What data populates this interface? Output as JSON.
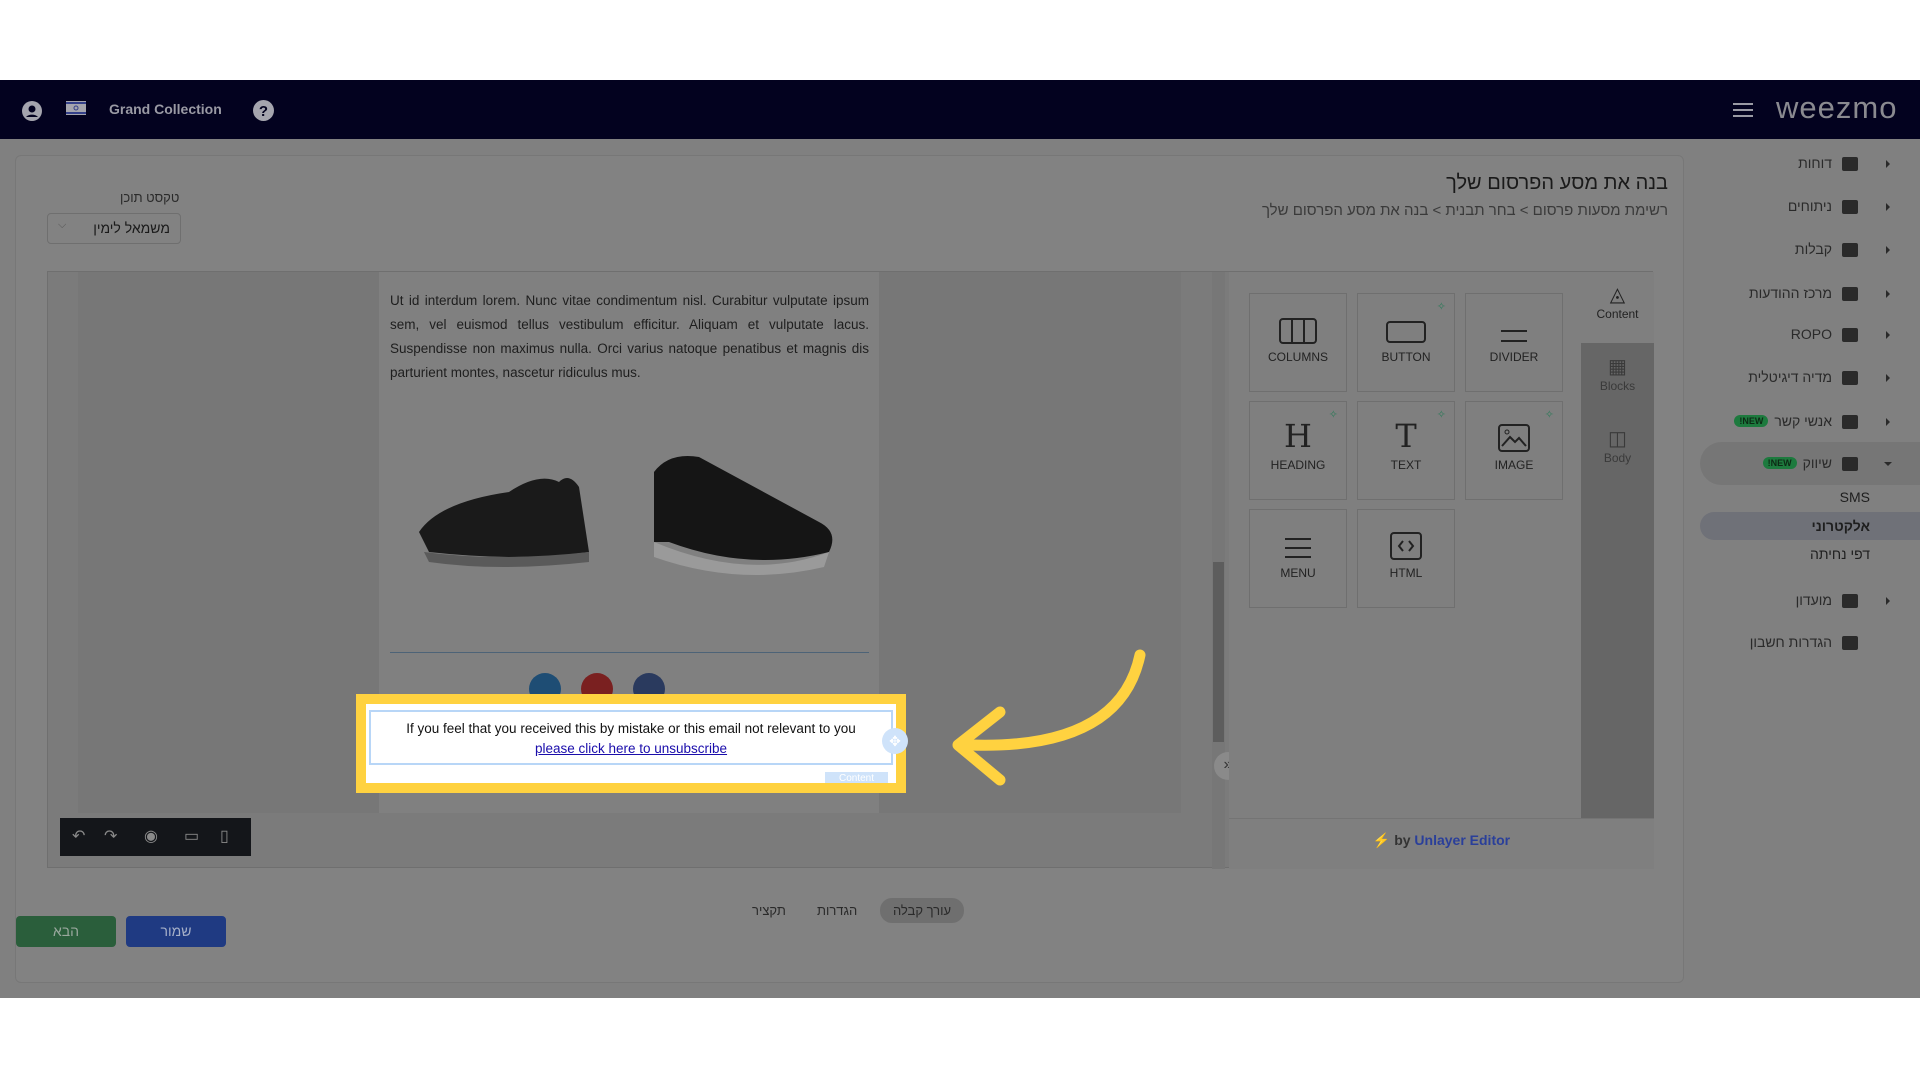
{
  "nav": {
    "store_name": "Grand Collection",
    "logo": "weezmo",
    "icons": [
      "user-icon",
      "israel-flag-icon",
      "help-icon",
      "menu-icon"
    ]
  },
  "header": {
    "title": "בנה את מסע הפרסום שלך",
    "breadcrumb": "רשימת מסעות פרסום > בחר תבנית > בנה את מסע הפרסום שלך"
  },
  "text_direction": {
    "label": "טקסט תוכן",
    "value": "משמאל לימין"
  },
  "sidebar": {
    "items": [
      {
        "label": "דוחות",
        "icon": "dashboard-icon"
      },
      {
        "label": "ניתוחים",
        "icon": "analytics-icon"
      },
      {
        "label": "קבלות",
        "icon": "receipt-icon"
      },
      {
        "label": "מרכז ההודעות",
        "icon": "message-icon"
      },
      {
        "label": "ROPO",
        "icon": "infinity-icon"
      },
      {
        "label": "מדיה דיגיטלית",
        "icon": "people-icon"
      },
      {
        "label": "אנשי קשר",
        "icon": "contact-icon",
        "badge": "NEW!"
      },
      {
        "label": "שיווק",
        "icon": "party-icon",
        "badge": "NEW!",
        "expanded": true
      },
      {
        "label": "מועדון",
        "icon": "tag-icon"
      },
      {
        "label": "הגדרות חשבון",
        "icon": "gear-icon"
      }
    ],
    "sub_items": [
      {
        "label": "SMS"
      },
      {
        "label": "אלקטרוני",
        "active": true
      },
      {
        "label": "דפי נחיתה"
      }
    ]
  },
  "email": {
    "body_text": "Ut id interdum lorem. Nunc vitae condimentum nisl. Curabitur vulputate ipsum sem, vel euismod tellus vestibulum efficitur. Aliquam et vulputate lacus. Suspendisse non maximus nulla. Orci varius natoque penatibus et magnis dis parturient montes, nascetur ridiculus mus.",
    "footer_text": "If you feel that you received this by mistake or this email not relevant to you",
    "unsubscribe_link": "please click here to unsubscribe",
    "content_tag": "Content",
    "social": [
      "linkedin-icon",
      "pinterest-icon",
      "facebook-icon"
    ]
  },
  "tools": {
    "tiles": [
      {
        "label": "COLUMNS",
        "ai": false
      },
      {
        "label": "BUTTON",
        "ai": true
      },
      {
        "label": "DIVIDER",
        "ai": false
      },
      {
        "label": "HEADING",
        "ai": true
      },
      {
        "label": "TEXT",
        "ai": true
      },
      {
        "label": "IMAGE",
        "ai": true
      },
      {
        "label": "MENU",
        "ai": false
      },
      {
        "label": "HTML",
        "ai": false
      }
    ],
    "tabs": [
      {
        "label": "Content",
        "active": true
      },
      {
        "label": "Blocks"
      },
      {
        "label": "Body"
      }
    ],
    "powered_by": "by",
    "powered_link": "Unlayer Editor"
  },
  "footer_tabs": [
    {
      "label": "עורך קבלה",
      "active": true
    },
    {
      "label": "הגדרות"
    },
    {
      "label": "תקציר"
    }
  ],
  "buttons": {
    "next": "הבא",
    "save": "שמור"
  },
  "colors": {
    "highlight": "#ffd240",
    "next": "#2a5e3b",
    "save": "#1f3a82",
    "link": "#1a0dab"
  }
}
